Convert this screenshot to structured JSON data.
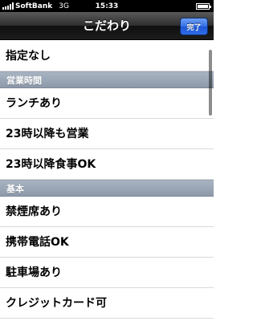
{
  "status_bar": {
    "carrier": "SoftBank",
    "network": "3G",
    "time": "15:33",
    "battery_level": 1.0
  },
  "nav_bar": {
    "title": "こだわり",
    "done_label": "完了",
    "done_color": "#2f6be8"
  },
  "list": {
    "none_option": "指定なし",
    "sections": [
      {
        "header": "営業時間",
        "items": [
          "ランチあり",
          "23時以降も営業",
          "23時以降食事OK"
        ]
      },
      {
        "header": "基本",
        "items": [
          "禁煙席あり",
          "携帯電話OK",
          "駐車場あり",
          "クレジットカード可"
        ]
      }
    ]
  }
}
